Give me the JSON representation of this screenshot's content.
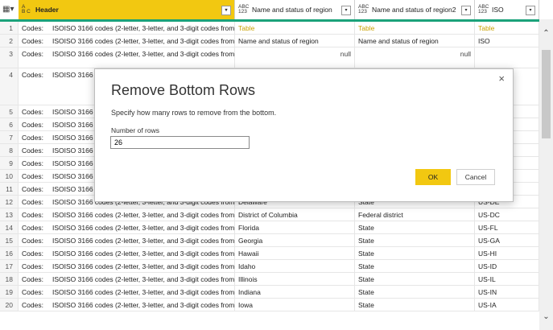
{
  "columns": [
    {
      "icon_top": "A",
      "icon_bottom": "B C",
      "label": "Header",
      "selected": true
    },
    {
      "icon_top": "ABC",
      "icon_bottom": "123",
      "label": "Name and status of region",
      "selected": false
    },
    {
      "icon_top": "ABC",
      "icon_bottom": "123",
      "label": "Name and status of region2",
      "selected": false
    },
    {
      "icon_top": "ABC",
      "icon_bottom": "123",
      "label": "ISO",
      "selected": false
    }
  ],
  "rows": [
    {
      "n": "1",
      "a": "Codes:",
      "b": "ISOISO 3166 codes (2-letter, 3-letter, and 3-digit codes from l...",
      "c": "Table",
      "d": "Table",
      "e": "Table",
      "type": "table"
    },
    {
      "n": "2",
      "a": "Codes:",
      "b": "ISOISO 3166 codes (2-letter, 3-letter, and 3-digit codes from l...",
      "c": "Name and status of region",
      "d": "Name and status of region",
      "e": "ISO",
      "type": "text"
    },
    {
      "n": "3",
      "a": "Codes:",
      "b": "ISOISO 3166 codes (2-letter, 3-letter, and 3-digit codes from l...",
      "c": "null",
      "d": "null",
      "e": "",
      "type": "null"
    },
    {
      "n": "4",
      "a": "Codes:",
      "b": "ISOISO 3166 c",
      "c": "",
      "d": "",
      "e": "",
      "type": "text"
    },
    {
      "n": "5",
      "a": "Codes:",
      "b": "ISOISO 3166 c",
      "c": "",
      "d": "",
      "e": "",
      "type": "text"
    },
    {
      "n": "6",
      "a": "Codes:",
      "b": "ISOISO 3166 c",
      "c": "",
      "d": "",
      "e": "",
      "type": "text"
    },
    {
      "n": "7",
      "a": "Codes:",
      "b": "ISOISO 3166 c",
      "c": "",
      "d": "",
      "e": "",
      "type": "text"
    },
    {
      "n": "8",
      "a": "Codes:",
      "b": "ISOISO 3166 c",
      "c": "",
      "d": "",
      "e": "",
      "type": "text"
    },
    {
      "n": "9",
      "a": "Codes:",
      "b": "ISOISO 3166 c",
      "c": "",
      "d": "",
      "e": "",
      "type": "text"
    },
    {
      "n": "10",
      "a": "Codes:",
      "b": "ISOISO 3166 c",
      "c": "",
      "d": "",
      "e": "",
      "type": "text"
    },
    {
      "n": "11",
      "a": "Codes:",
      "b": "ISOISO 3166 codes (2-letter, 3-letter, and 3-digit codes from l...",
      "c": "Connecticut",
      "d": "State",
      "e": "US-CT",
      "type": "text"
    },
    {
      "n": "12",
      "a": "Codes:",
      "b": "ISOISO 3166 codes (2-letter, 3-letter, and 3-digit codes from l...",
      "c": "Delaware",
      "d": "State",
      "e": "US-DE",
      "type": "text"
    },
    {
      "n": "13",
      "a": "Codes:",
      "b": "ISOISO 3166 codes (2-letter, 3-letter, and 3-digit codes from l...",
      "c": "District of Columbia",
      "d": "Federal district",
      "e": "US-DC",
      "type": "text"
    },
    {
      "n": "14",
      "a": "Codes:",
      "b": "ISOISO 3166 codes (2-letter, 3-letter, and 3-digit codes from l...",
      "c": "Florida",
      "d": "State",
      "e": "US-FL",
      "type": "text"
    },
    {
      "n": "15",
      "a": "Codes:",
      "b": "ISOISO 3166 codes (2-letter, 3-letter, and 3-digit codes from l...",
      "c": "Georgia",
      "d": "State",
      "e": "US-GA",
      "type": "text"
    },
    {
      "n": "16",
      "a": "Codes:",
      "b": "ISOISO 3166 codes (2-letter, 3-letter, and 3-digit codes from l...",
      "c": "Hawaii",
      "d": "State",
      "e": "US-HI",
      "type": "text"
    },
    {
      "n": "17",
      "a": "Codes:",
      "b": "ISOISO 3166 codes (2-letter, 3-letter, and 3-digit codes from l...",
      "c": "Idaho",
      "d": "State",
      "e": "US-ID",
      "type": "text"
    },
    {
      "n": "18",
      "a": "Codes:",
      "b": "ISOISO 3166 codes (2-letter, 3-letter, and 3-digit codes from l...",
      "c": "Illinois",
      "d": "State",
      "e": "US-IL",
      "type": "text"
    },
    {
      "n": "19",
      "a": "Codes:",
      "b": "ISOISO 3166 codes (2-letter, 3-letter, and 3-digit codes from l...",
      "c": "Indiana",
      "d": "State",
      "e": "US-IN",
      "type": "text"
    },
    {
      "n": "20",
      "a": "Codes:",
      "b": "ISOISO 3166 codes (2-letter, 3-letter, and 3-digit codes from l...",
      "c": "Iowa",
      "d": "State",
      "e": "US-IA",
      "type": "text"
    }
  ],
  "dialog": {
    "title": "Remove Bottom Rows",
    "description": "Specify how many rows to remove from the bottom.",
    "field_label": "Number of rows",
    "field_value": "26",
    "ok_label": "OK",
    "cancel_label": "Cancel",
    "close_glyph": "×"
  },
  "colors": {
    "accent": "#f2c811",
    "header_rule": "#1ba27a",
    "table_text": "#c9a000"
  }
}
